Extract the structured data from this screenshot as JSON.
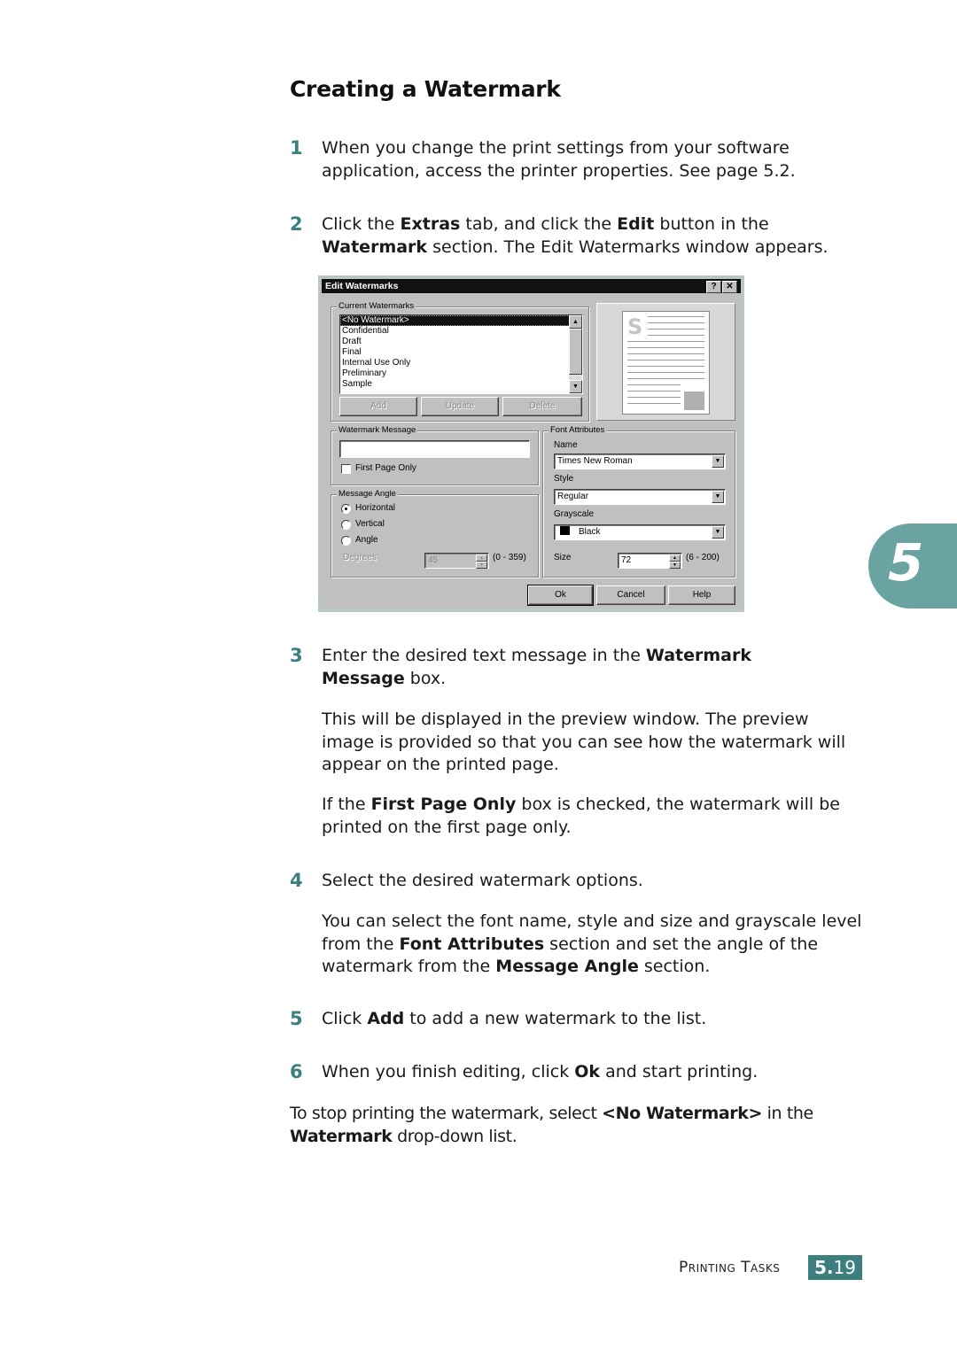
{
  "title": "Creating a Watermark",
  "steps": [
    {
      "num": "1",
      "text": "When you change the print settings from your software application, access the printer properties. See page 5.2."
    },
    {
      "num": "2",
      "parts": [
        "Click the ",
        "Extras",
        " tab, and click the ",
        "Edit",
        " button in the ",
        "Watermark",
        " section. The Edit Watermarks window appears."
      ]
    },
    {
      "num": "3",
      "parts": [
        "Enter the desired text message in the ",
        "Watermark Message",
        " box."
      ]
    },
    {
      "num": "4",
      "text": "Select the desired watermark options."
    },
    {
      "num": "5",
      "parts": [
        "Click ",
        "Add",
        " to add a new watermark to the list."
      ]
    },
    {
      "num": "6",
      "parts": [
        "When you finish editing, click ",
        "Ok",
        " and start printing."
      ]
    }
  ],
  "paragraphs": {
    "preview": "This will be displayed in the preview window. The preview image is provided so that you can see how the watermark will appear on the printed page.",
    "first_page": [
      "If the ",
      "First Page Only",
      " box is checked, the watermark will be printed on the first page only."
    ],
    "font_attr": [
      "You can select the font name, style and size and grayscale level from the ",
      "Font Attributes",
      " section and set the angle of the watermark from the ",
      "Message Angle",
      " section."
    ],
    "stop": [
      "To stop printing the watermark, select ",
      "<No Watermark>",
      " in the ",
      "Watermark",
      " drop-down list."
    ]
  },
  "dialog": {
    "title": "Edit Watermarks",
    "help_btn": "?",
    "close_btn": "✕",
    "current_group": "Current Watermarks",
    "watermarks": [
      "<No Watermark>",
      "Confidential",
      "Draft",
      "Final",
      "Internal Use Only",
      "Preliminary",
      "Sample"
    ],
    "selected_index": 0,
    "add": "Add",
    "update": "Update",
    "delete": "Delete",
    "message_group": "Watermark Message",
    "message_value": "",
    "first_page_only": "First Page Only",
    "first_page_checked": false,
    "angle_group": "Message Angle",
    "angle_options": [
      "Horizontal",
      "Vertical",
      "Angle"
    ],
    "angle_selected": "Horizontal",
    "degrees_label": "Degrees",
    "degrees_value": "45",
    "degrees_range": "(0 - 359)",
    "font_group": "Font Attributes",
    "name_label": "Name",
    "name_value": "Times New Roman",
    "style_label": "Style",
    "style_value": "Regular",
    "grayscale_label": "Grayscale",
    "grayscale_value": "Black",
    "size_label": "Size",
    "size_value": "72",
    "size_range": "(6 - 200)",
    "ok": "Ok",
    "cancel": "Cancel",
    "help": "Help",
    "preview_letter": "S"
  },
  "chapter": "5",
  "footer": {
    "section": "Printing Tasks",
    "page_major": "5.",
    "page_minor": "19"
  },
  "colors": {
    "accent": "#3d7f7e",
    "chapter_tab": "#6aa3a2"
  }
}
